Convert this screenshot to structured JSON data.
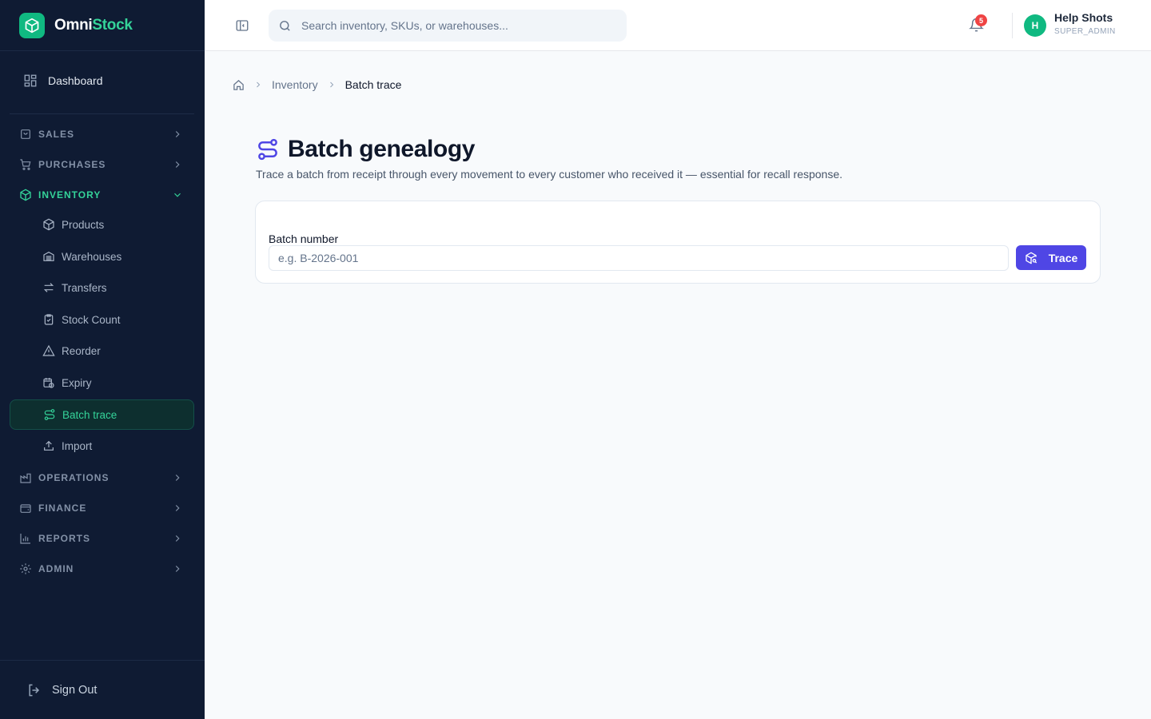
{
  "brand": {
    "part1": "Omni",
    "part2": "Stock"
  },
  "sidebar": {
    "dashboard": "Dashboard",
    "sections": {
      "sales": "SALES",
      "purchases": "PURCHASES",
      "inventory": "INVENTORY",
      "operations": "OPERATIONS",
      "finance": "FINANCE",
      "reports": "REPORTS",
      "admin": "ADMIN"
    },
    "inventory_items": {
      "products": "Products",
      "warehouses": "Warehouses",
      "transfers": "Transfers",
      "stock_count": "Stock Count",
      "reorder": "Reorder",
      "expiry": "Expiry",
      "batch_trace": "Batch trace",
      "import": "Import"
    },
    "signout": "Sign Out"
  },
  "header": {
    "search_placeholder": "Search inventory, SKUs, or warehouses...",
    "notifications_count": "5",
    "user_initial": "H",
    "user_name": "Help Shots",
    "user_role": "SUPER_ADMIN"
  },
  "breadcrumb": {
    "level1": "Inventory",
    "level2": "Batch trace"
  },
  "page": {
    "title": "Batch genealogy",
    "subtitle": "Trace a batch from receipt through every movement to every customer who received it — essential for recall response."
  },
  "form": {
    "label": "Batch number",
    "placeholder": "e.g. B-2026-001",
    "value": "",
    "button": "Trace"
  },
  "colors": {
    "accent": "#4f46e5",
    "brand": "#10b981",
    "sidebar_bg": "#0f1b33",
    "active_green": "#34d399"
  }
}
